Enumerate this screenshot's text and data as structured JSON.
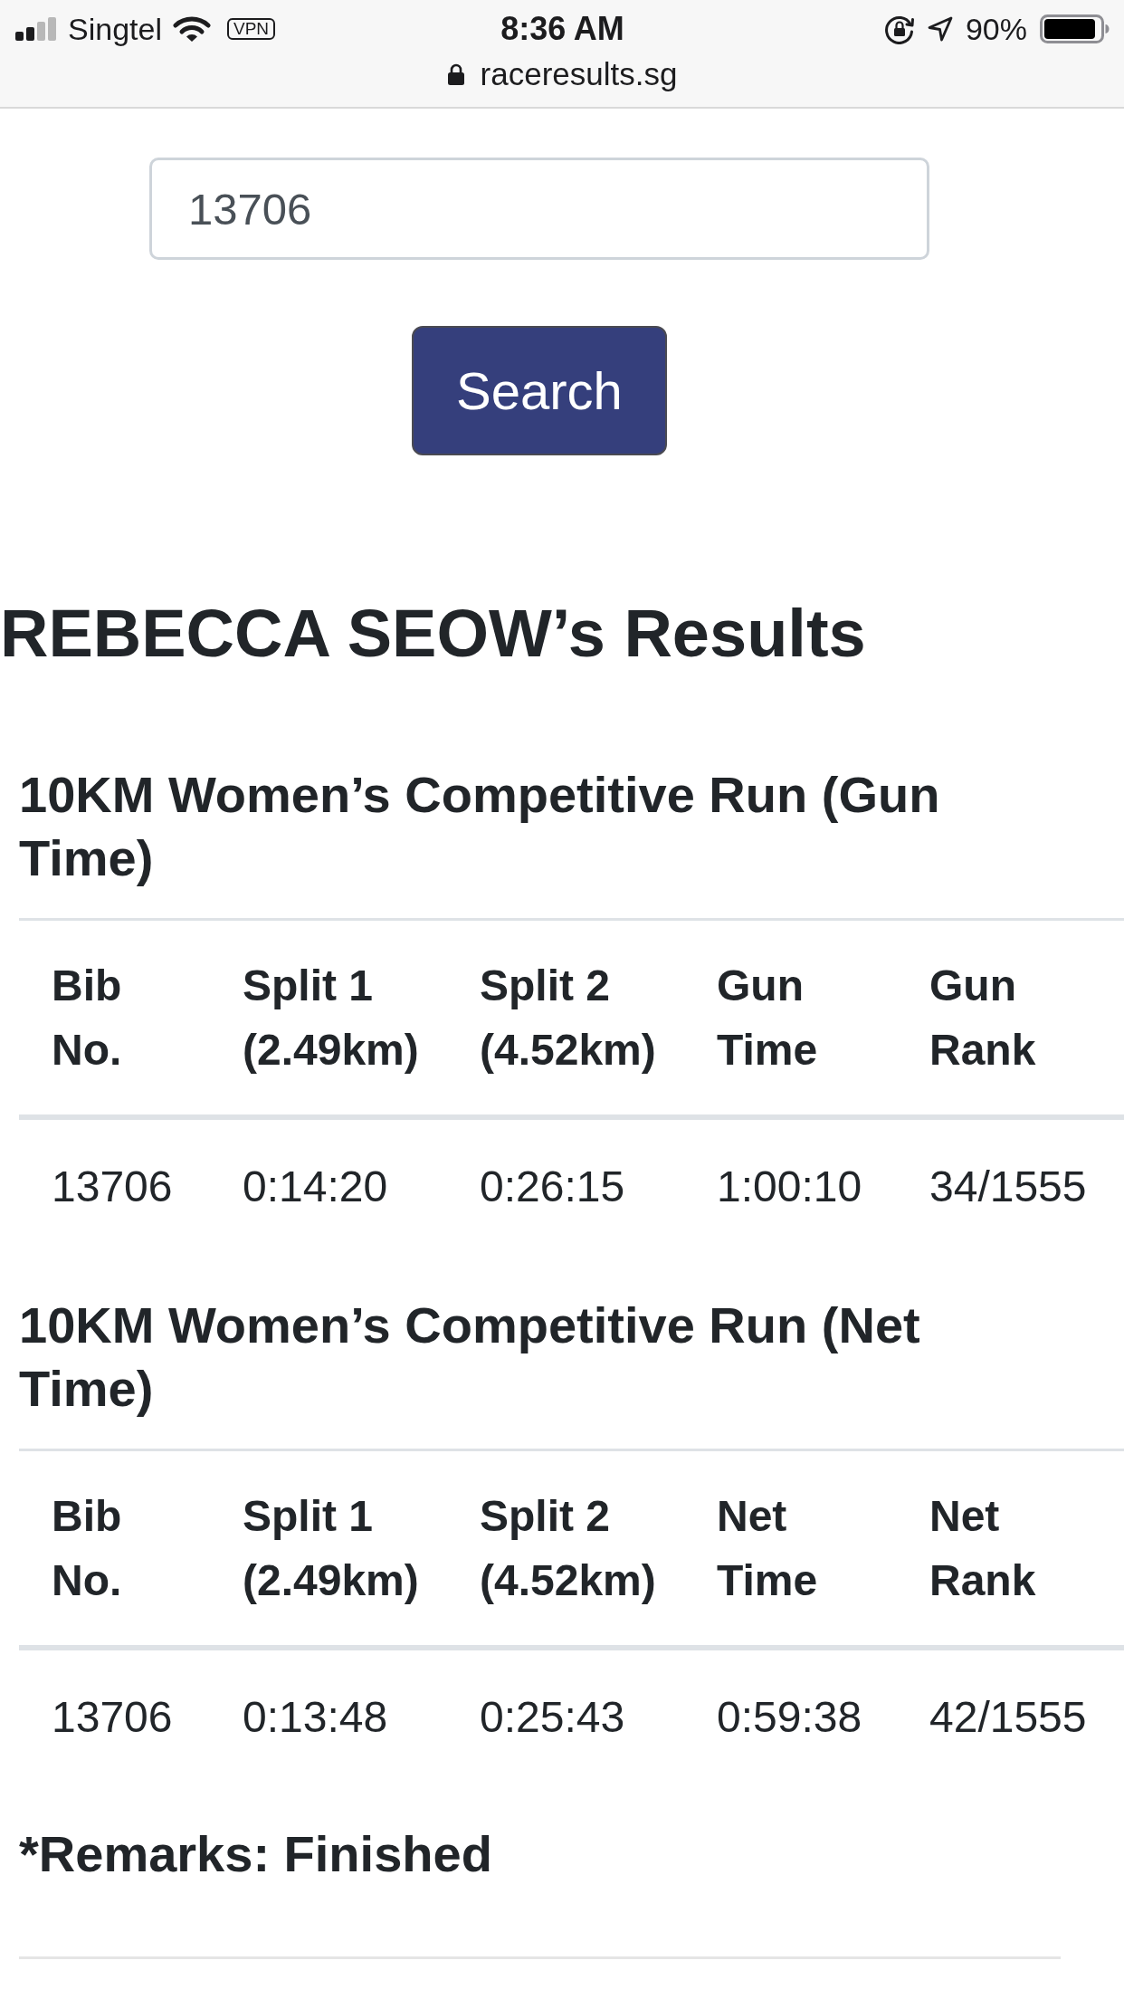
{
  "status_bar": {
    "carrier": "Singtel",
    "vpn": "VPN",
    "time": "8:36 AM",
    "battery_percent": "90%"
  },
  "address_bar": {
    "url": "raceresults.sg"
  },
  "search": {
    "value": "13706",
    "button": "Search"
  },
  "title": "REBECCA SEOW’s Results",
  "results": [
    {
      "title": "10KM Women’s Competitive Run (Gun Time)",
      "columns": [
        "Bib No.",
        "Split 1 (2.49km)",
        "Split 2 (4.52km)",
        "Gun Time",
        "Gun Rank"
      ],
      "rows": [
        [
          "13706",
          "0:14:20",
          "0:26:15",
          "1:00:10",
          "34/1555"
        ]
      ]
    },
    {
      "title": "10KM Women’s Competitive Run (Net Time)",
      "columns": [
        "Bib No.",
        "Split 1 (2.49km)",
        "Split 2 (4.52km)",
        "Net Time",
        "Net Rank"
      ],
      "rows": [
        [
          "13706",
          "0:13:48",
          "0:25:43",
          "0:59:38",
          "42/1555"
        ]
      ]
    }
  ],
  "remarks": "*Remarks: Finished"
}
